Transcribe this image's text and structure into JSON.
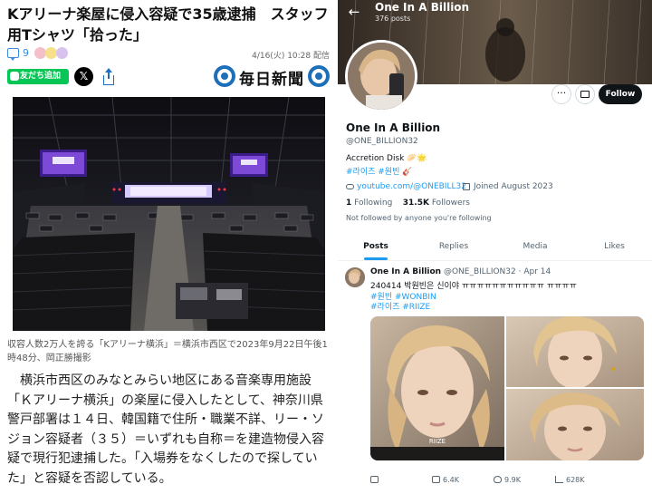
{
  "article": {
    "headline": "Kアリーナ楽屋に侵入容疑で35歳逮捕　スタッフ用Tシャツ「拾った」",
    "comment_count": "9",
    "date": "4/16(火) 10:28 配信",
    "line_button": "友だち追加",
    "x_icon": "𝕏",
    "publisher": "毎日新聞",
    "photo_caption": "収容人数2万人を誇る「Kアリーナ横浜」＝横浜市西区で2023年9月22日午後1時48分、岡正勝撮影",
    "body": "横浜市西区のみなとみらい地区にある音楽専用施設「Ｋアリーナ横浜」の楽屋に侵入したとして、神奈川県警戸部署は１４日、韓国籍で住所・職業不詳、リー・ソジョン容疑者（３５）＝いずれも自称＝を建造物侵入容疑で現行犯逮捕した。「入場券をなくしたので探していた」と容疑を否認している。"
  },
  "profile": {
    "top_name": "One In A Billion",
    "top_posts": "376 posts",
    "back": "←",
    "more_label": "···",
    "follow_label": "Follow",
    "name": "One In A Billion",
    "handle": "@ONE_BILLION32",
    "bio_line1": "Accretion Disk 🥟🌟",
    "bio_line2": "#라이즈 #원빈 🎸",
    "link": "youtube.com/@ONEBILL32",
    "joined": "Joined August 2023",
    "following_count": "1",
    "following_label": "Following",
    "followers_count": "31.5K",
    "followers_label": "Followers",
    "not_followed": "Not followed by anyone you're following",
    "tabs": [
      "Posts",
      "Replies",
      "Media",
      "Likes"
    ]
  },
  "tweet": {
    "name": "One In A Billion",
    "meta": "@ONE_BILLION32 · Apr 14",
    "text": "240414 박원빈은 신이야 ㅠㅠㅠㅠㅠㅠㅠㅠㅠㅠㅠ ㅠㅠㅠㅠ",
    "tags1": "#원빈 #WONBIN",
    "tags2": "#라이즈 #RIIZE",
    "image_text": "RIIZE",
    "retweets": "6.4K",
    "likes": "9.9K",
    "views": "628K"
  },
  "colors": {
    "link_blue": "#1d9bf0",
    "line_green": "#06c755",
    "mainichi_blue": "#1d6fb8"
  }
}
